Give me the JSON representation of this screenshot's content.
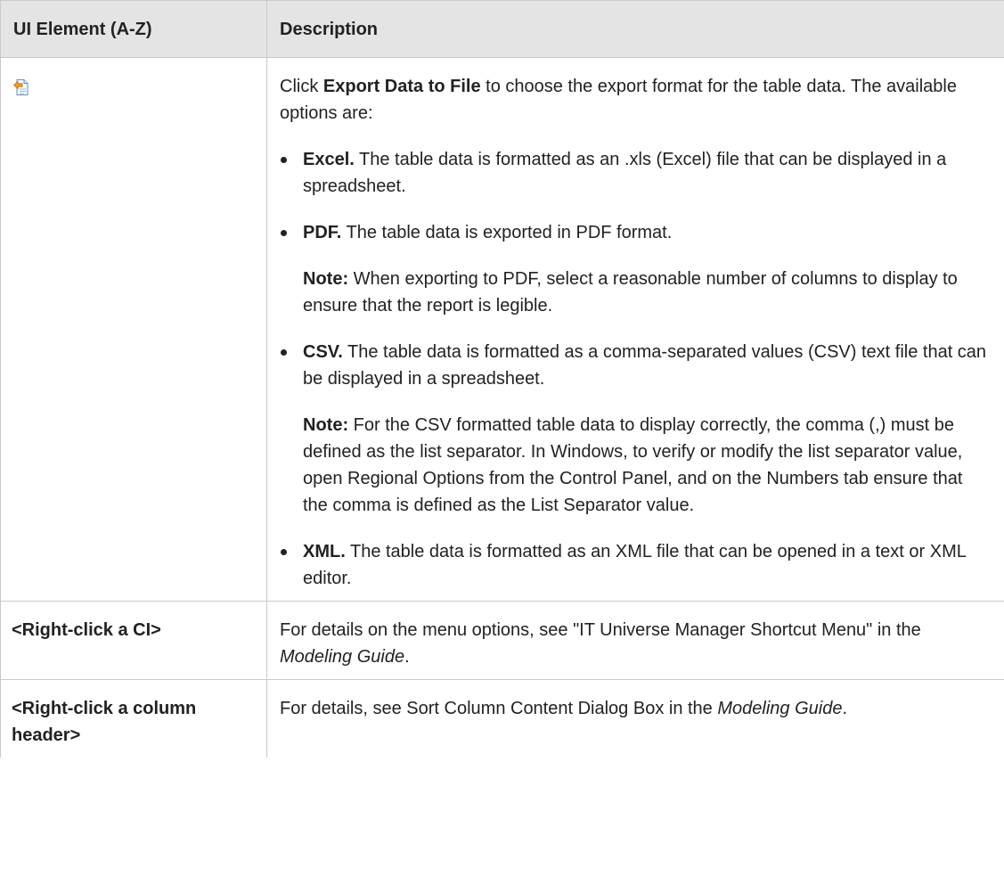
{
  "table": {
    "headers": [
      "UI Element (A-Z)",
      "Description"
    ],
    "rows": {
      "export": {
        "icon": "export-data-to-file-icon",
        "intro_pre": "Click ",
        "intro_bold": "Export Data to File",
        "intro_post": " to choose the export format for the table data. The available options are:",
        "options": [
          {
            "name": "Excel.",
            "text": " The table data is formatted as an .xls (Excel) file that can be displayed in a spreadsheet."
          },
          {
            "name": "PDF.",
            "text": " The table data is exported in PDF format.",
            "note_label": "Note:",
            "note_text": " When exporting to PDF, select a reasonable number of columns to display to ensure that the report is legible."
          },
          {
            "name": "CSV.",
            "text": " The table data is formatted as a comma-separated values (CSV) text file that can be displayed in a spreadsheet.",
            "note_label": "Note:",
            "note_text": " For the CSV formatted table data to display correctly, the comma (,) must be defined as the list separator. In Windows, to verify or modify the list separator value, open Regional Options from the Control Panel, and on the Numbers tab ensure that the comma is defined as the List Separator value."
          },
          {
            "name": "XML.",
            "text": " The table data is formatted as an XML file that can be opened in a text or XML editor."
          }
        ]
      },
      "right_click_ci": {
        "element": "<Right-click a CI>",
        "desc_pre": "For details on the menu options, see \"IT Universe Manager Shortcut Menu\" in the ",
        "desc_italic": "Modeling Guide",
        "desc_post": "."
      },
      "right_click_header": {
        "element": "<Right-click a column header>",
        "desc_pre": "For details, see Sort Column Content Dialog Box in the ",
        "desc_italic": "Modeling Guide",
        "desc_post": "."
      }
    }
  }
}
